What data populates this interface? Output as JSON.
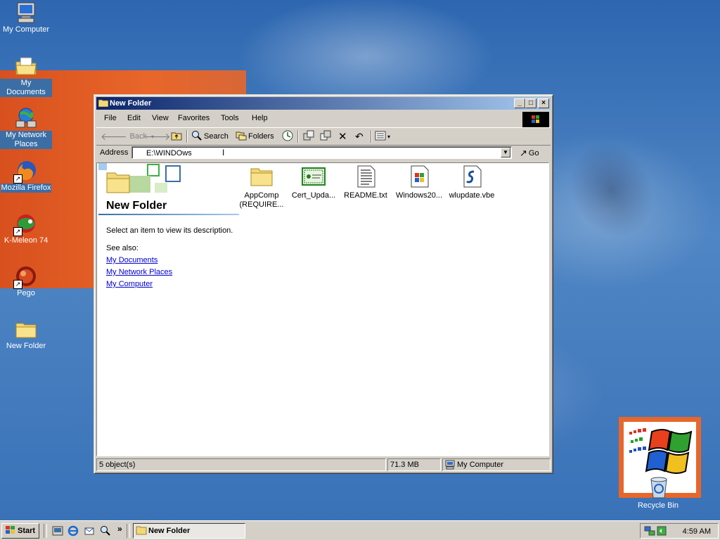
{
  "desktop": {
    "icons": [
      {
        "label": "My Computer",
        "icon": "my-computer-icon"
      },
      {
        "label": "My Documents",
        "icon": "my-documents-icon"
      },
      {
        "label": "My Network Places",
        "icon": "network-places-icon"
      },
      {
        "label": "Mozilla Firefox",
        "icon": "firefox-icon"
      },
      {
        "label": "K-Meleon 74",
        "icon": "k-meleon-icon"
      },
      {
        "label": "Pego",
        "icon": "pego-icon"
      },
      {
        "label": "New Folder",
        "icon": "folder-icon"
      }
    ],
    "recycle_bin": {
      "label": "Recycle Bin",
      "icon": "recycle-bin-icon"
    }
  },
  "window": {
    "title": "New Folder",
    "menu": [
      "File",
      "Edit",
      "View",
      "Favorites",
      "Tools",
      "Help"
    ],
    "toolbar": {
      "back": "Back",
      "search": "Search",
      "folders": "Folders"
    },
    "address": {
      "label": "Address",
      "value": "E:\\WINDOws",
      "go": "Go"
    },
    "webview": {
      "folder_title": "New Folder",
      "description": "Select an item to view its description.",
      "see_also": "See also:",
      "links": [
        "My Documents",
        "My Network Places",
        "My Computer"
      ]
    },
    "files": [
      {
        "name": "AppComp",
        "name2": "(REQUIRE...",
        "icon": "folder-icon"
      },
      {
        "name": "Cert_Upda...",
        "icon": "certificate-icon"
      },
      {
        "name": "README.txt",
        "icon": "text-file-icon"
      },
      {
        "name": "Windows20...",
        "icon": "installer-icon"
      },
      {
        "name": "wlupdate.vbe",
        "icon": "script-file-icon"
      }
    ],
    "status": {
      "objects": "5 object(s)",
      "size": "71.3 MB",
      "zone": "My Computer"
    }
  },
  "taskbar": {
    "start": "Start",
    "task": "New Folder",
    "clock": "4:59 AM"
  },
  "colors": {
    "desktop_blue": "#3a6ea5",
    "accent_orange": "#e8662a",
    "titlebar_start": "#0a246a",
    "titlebar_end": "#a6caf0",
    "chrome": "#d4d0c8"
  }
}
